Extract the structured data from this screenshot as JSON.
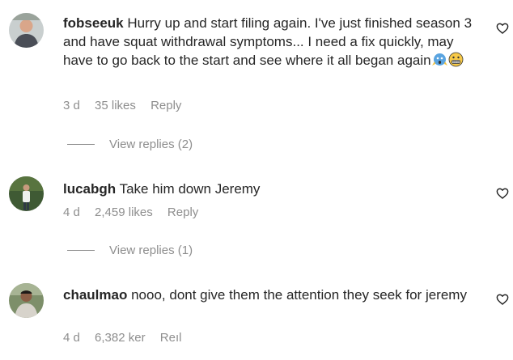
{
  "comments": [
    {
      "username": "fobseeuk",
      "text": "Hurry up and start filing again. I've just finished season 3 and have squat withdrawal symptoms... I need a fix quickly, may have to go back to the start and see where it all began again",
      "emojis": [
        "face-screaming-in-fear-emoji",
        "grimacing-face-emoji"
      ],
      "age": "3 d",
      "likes": "35 likes",
      "reply_label": "Reply",
      "view_replies": "View replies (2)"
    },
    {
      "username": "lucabgh",
      "text": "Take him down Jeremy",
      "age": "4 d",
      "likes": "2,459 likes",
      "reply_label": "Reply",
      "view_replies": "View replies (1)"
    },
    {
      "username": "chaulmao",
      "text": "nooo, dont give them the attention they seek for jeremy",
      "age": "4 d",
      "likes": "6,382 ",
      "likes_cut": "ker",
      "reply_label": "Re",
      "reply_cut": "ıl"
    }
  ],
  "colors": {
    "text": "#262626",
    "meta": "#8e8e8e",
    "background": "#ffffff"
  },
  "icons": {
    "like": "heart-outline-icon"
  }
}
